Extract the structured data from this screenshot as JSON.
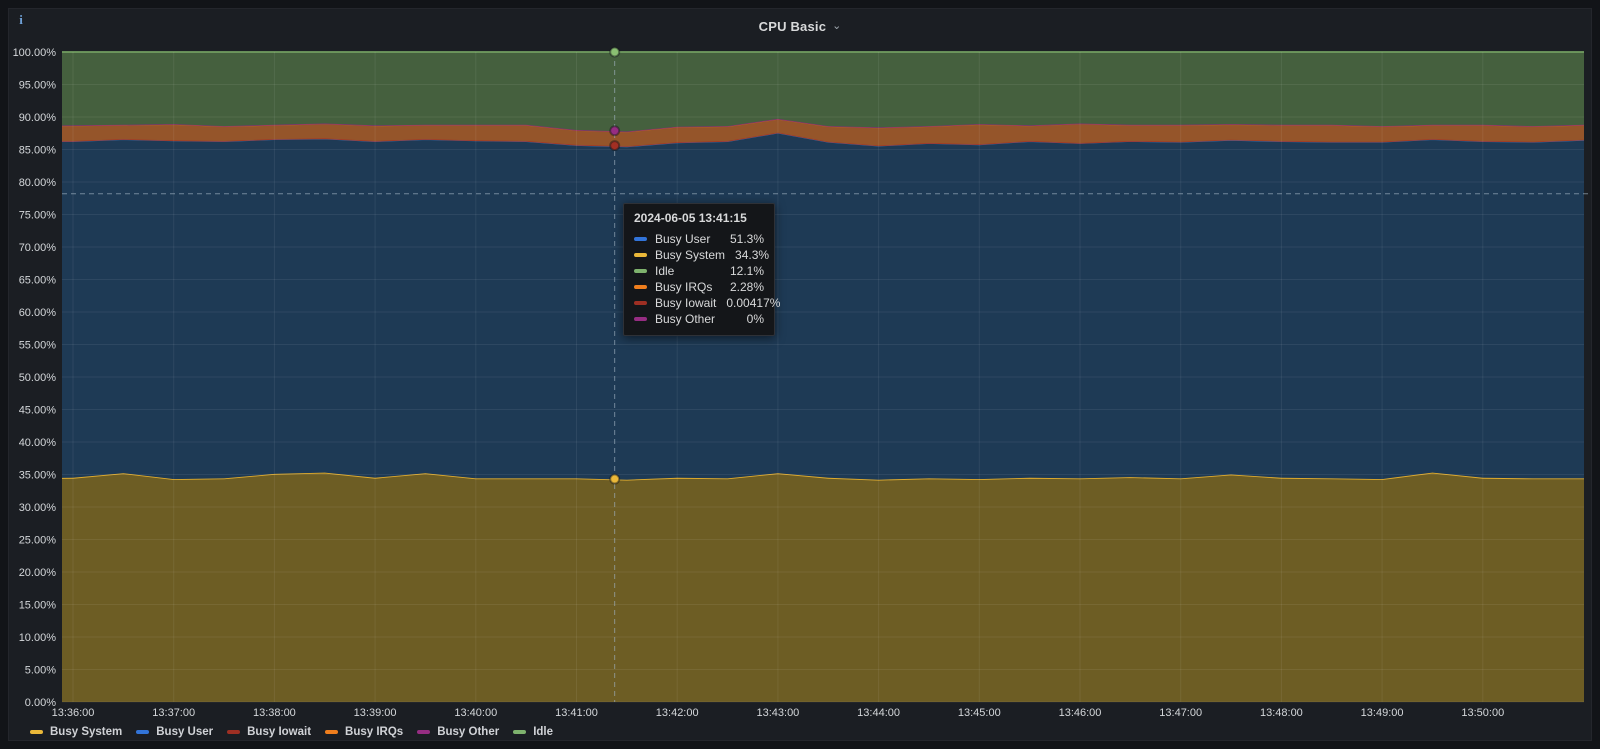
{
  "panel": {
    "title": "CPU Basic",
    "icons": {
      "chevron": "⌄",
      "info": "i"
    }
  },
  "tooltip": {
    "timestamp": "2024-06-05 13:41:15",
    "rows": [
      {
        "name": "Busy User",
        "value": "51.3%",
        "color": "#3274d9"
      },
      {
        "name": "Busy System",
        "value": "34.3%",
        "color": "#eab839"
      },
      {
        "name": "Idle",
        "value": "12.1%",
        "color": "#7eb26d"
      },
      {
        "name": "Busy IRQs",
        "value": "2.28%",
        "color": "#ef7e1d"
      },
      {
        "name": "Busy Iowait",
        "value": "0.00417%",
        "color": "#9e2f23"
      },
      {
        "name": "Busy Other",
        "value": "0%",
        "color": "#962d82"
      }
    ]
  },
  "legend": {
    "items": [
      {
        "name": "Busy System",
        "color": "#eab839"
      },
      {
        "name": "Busy User",
        "color": "#3274d9"
      },
      {
        "name": "Busy Iowait",
        "color": "#9e2f23"
      },
      {
        "name": "Busy IRQs",
        "color": "#ef7e1d"
      },
      {
        "name": "Busy Other",
        "color": "#962d82"
      },
      {
        "name": "Idle",
        "color": "#7eb26d"
      }
    ]
  },
  "chart_data": {
    "type": "area",
    "stacked": true,
    "title": "CPU Basic",
    "unit": "percent",
    "ylim": [
      0,
      100
    ],
    "grid": true,
    "legend_position": "bottom",
    "y_tick_labels": [
      "0.00%",
      "5.00%",
      "10.00%",
      "15.00%",
      "20.00%",
      "25.00%",
      "30.00%",
      "35.00%",
      "40.00%",
      "45.00%",
      "50.00%",
      "55.00%",
      "60.00%",
      "65.00%",
      "70.00%",
      "75.00%",
      "80.00%",
      "85.00%",
      "90.00%",
      "95.00%",
      "100.00%"
    ],
    "x_tick_labels": [
      "13:36:00",
      "13:37:00",
      "13:38:00",
      "13:39:00",
      "13:40:00",
      "13:41:00",
      "13:42:00",
      "13:43:00",
      "13:44:00",
      "13:45:00",
      "13:46:00",
      "13:47:00",
      "13:48:00",
      "13:49:00",
      "13:50:00"
    ],
    "time_offsets_s": [
      -30,
      0,
      30,
      60,
      90,
      120,
      150,
      180,
      210,
      240,
      270,
      300,
      330,
      360,
      390,
      420,
      450,
      480,
      510,
      540,
      570,
      600,
      630,
      660,
      690,
      720,
      750,
      780,
      810,
      840,
      870,
      900,
      930
    ],
    "series": [
      {
        "name": "Busy System",
        "stroke": "#e0ac2f",
        "fill": "#6d5d24",
        "values": [
          34.4,
          34.5,
          35.2,
          34.3,
          34.4,
          35.1,
          35.3,
          34.5,
          35.2,
          34.4,
          34.4,
          34.4,
          34.2,
          34.5,
          34.4,
          35.2,
          34.5,
          34.2,
          34.4,
          34.3,
          34.5,
          34.4,
          34.6,
          34.4,
          35.0,
          34.5,
          34.4,
          34.3,
          35.3,
          34.5,
          34.4,
          34.4,
          34.4
        ]
      },
      {
        "name": "Busy User",
        "stroke": "#3a77c2",
        "fill": "#1e3a55",
        "values": [
          51.9,
          51.8,
          51.4,
          52.1,
          51.9,
          51.5,
          51.4,
          51.8,
          51.4,
          52.0,
          51.9,
          51.3,
          51.3,
          51.6,
          51.9,
          52.4,
          51.7,
          51.4,
          51.6,
          51.5,
          51.8,
          51.6,
          51.7,
          51.8,
          51.5,
          51.8,
          51.8,
          51.9,
          51.3,
          51.8,
          51.8,
          52.1,
          52.1
        ]
      },
      {
        "name": "Busy Iowait",
        "stroke": "#a33426",
        "fill": "#5a2018",
        "values": [
          0.004,
          0.004,
          0.004,
          0.004,
          0.004,
          0.004,
          0.004,
          0.004,
          0.004,
          0.004,
          0.004,
          0.004,
          0.004,
          0.004,
          0.004,
          0.004,
          0.004,
          0.004,
          0.004,
          0.004,
          0.004,
          0.004,
          0.004,
          0.004,
          0.004,
          0.004,
          0.004,
          0.004,
          0.004,
          0.004,
          0.004,
          0.004,
          0.004
        ]
      },
      {
        "name": "Busy IRQs",
        "stroke": "#cf6a1f",
        "fill": "#95552a",
        "values": [
          2.3,
          2.4,
          2.2,
          2.5,
          2.3,
          2.2,
          2.3,
          2.4,
          2.2,
          2.4,
          2.5,
          2.3,
          2.26,
          2.4,
          2.3,
          2.1,
          2.4,
          2.8,
          2.6,
          3.1,
          2.4,
          3.0,
          2.5,
          2.6,
          2.4,
          2.5,
          2.6,
          2.4,
          2.2,
          2.5,
          2.4,
          2.3,
          2.3
        ]
      },
      {
        "name": "Busy Other",
        "stroke": "#8a3070",
        "fill": "#962d82",
        "values": [
          0,
          0,
          0,
          0,
          0,
          0,
          0,
          0,
          0,
          0,
          0,
          0,
          0,
          0,
          0,
          0,
          0,
          0,
          0,
          0,
          0,
          0,
          0,
          0,
          0,
          0,
          0,
          0,
          0,
          0,
          0,
          0,
          0
        ]
      },
      {
        "name": "Idle",
        "stroke": "#6d9a5b",
        "fill": "#45603e",
        "values": [
          11.396,
          11.296,
          11.196,
          11.096,
          11.396,
          11.196,
          10.996,
          11.296,
          11.196,
          11.196,
          11.196,
          11.996,
          12.236,
          11.496,
          11.396,
          10.296,
          11.396,
          11.596,
          11.396,
          11.096,
          11.296,
          10.996,
          11.196,
          11.196,
          11.096,
          11.196,
          11.196,
          11.396,
          11.196,
          11.196,
          11.396,
          11.196,
          11.196
        ]
      }
    ],
    "crosshair": {
      "time": "13:41:15",
      "time_offset_s": 315,
      "cursor_y_percent": 78.2
    },
    "markers": [
      {
        "series": "Idle",
        "percent": 100,
        "color": "#8abf72"
      },
      {
        "series": "Busy Other",
        "percent": 87.884,
        "color": "#962d82"
      },
      {
        "series": "Busy Iowait",
        "percent": 85.604,
        "color": "#a22f23"
      },
      {
        "series": "Busy System",
        "percent": 34.3,
        "color": "#eab839"
      }
    ]
  }
}
